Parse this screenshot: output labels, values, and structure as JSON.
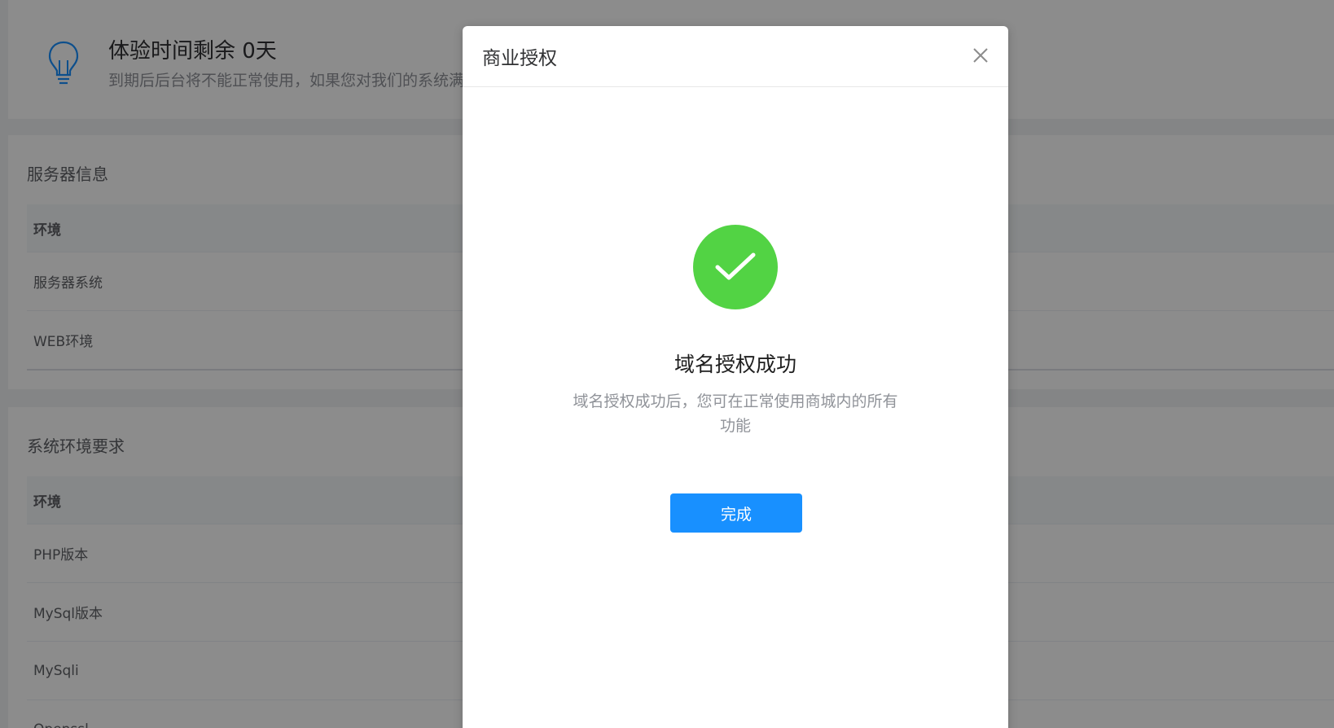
{
  "trial": {
    "title": "体验时间剩余 0天",
    "description": "到期后后台将不能正常使用，如果您对我们的系统满意，请及时购买授权"
  },
  "server_info": {
    "title": "服务器信息",
    "header": "环境",
    "rows": [
      "服务器系统",
      "WEB环境"
    ]
  },
  "requirements": {
    "title": "系统环境要求",
    "header": "环境",
    "rows": [
      "PHP版本",
      "MySql版本",
      "MySqli",
      "Openssl"
    ]
  },
  "dialog": {
    "title": "商业授权",
    "result_title": "域名授权成功",
    "result_desc": "域名授权成功后，您可在正常使用商城内的所有功能",
    "done_label": "完成",
    "icon": "check-circle-icon",
    "colors": {
      "success": "#52d344",
      "primary": "#1890ff"
    }
  }
}
